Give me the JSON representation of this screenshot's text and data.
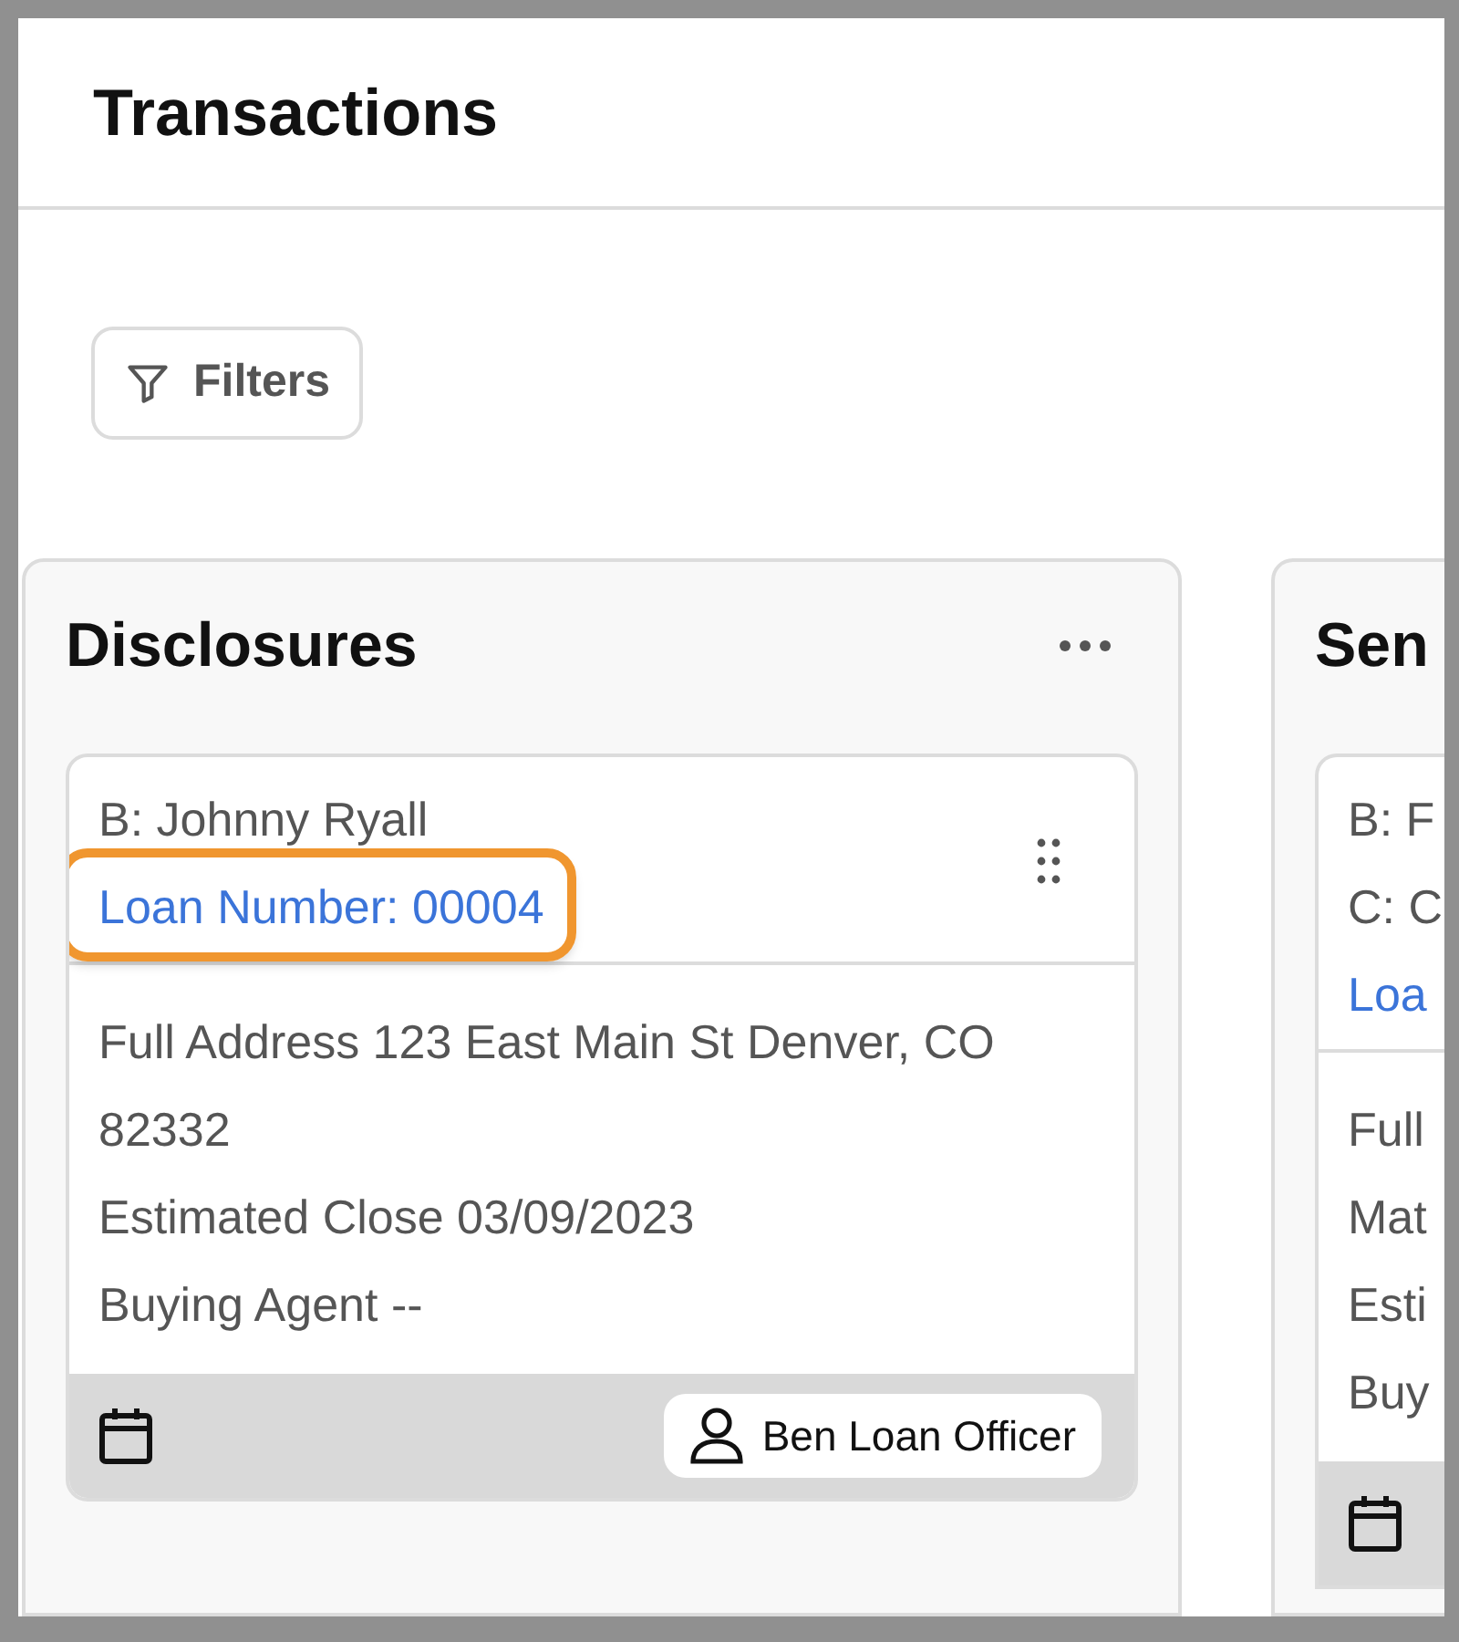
{
  "header": {
    "title": "Transactions"
  },
  "toolbar": {
    "filters_button": "Filters"
  },
  "columns": [
    {
      "title": "Disclosures",
      "has_menu": true,
      "cards": [
        {
          "header_lines": [
            "B: Johnny Ryall"
          ],
          "loan_number": "Loan Number: 00004",
          "highlighted": true,
          "details": [
            "Full Address 123 East Main St Denver, CO 82332",
            "Estimated Close 03/09/2023",
            "Buying Agent --"
          ],
          "assignee": "Ben Loan Officer"
        }
      ]
    },
    {
      "title": "Sen",
      "has_menu": false,
      "cards": [
        {
          "header_lines": [
            "B: F",
            "C: C"
          ],
          "loan_number": "Loa",
          "highlighted": false,
          "details": [
            "Full",
            "Mat",
            "Esti",
            "Buy"
          ]
        }
      ]
    }
  ]
}
